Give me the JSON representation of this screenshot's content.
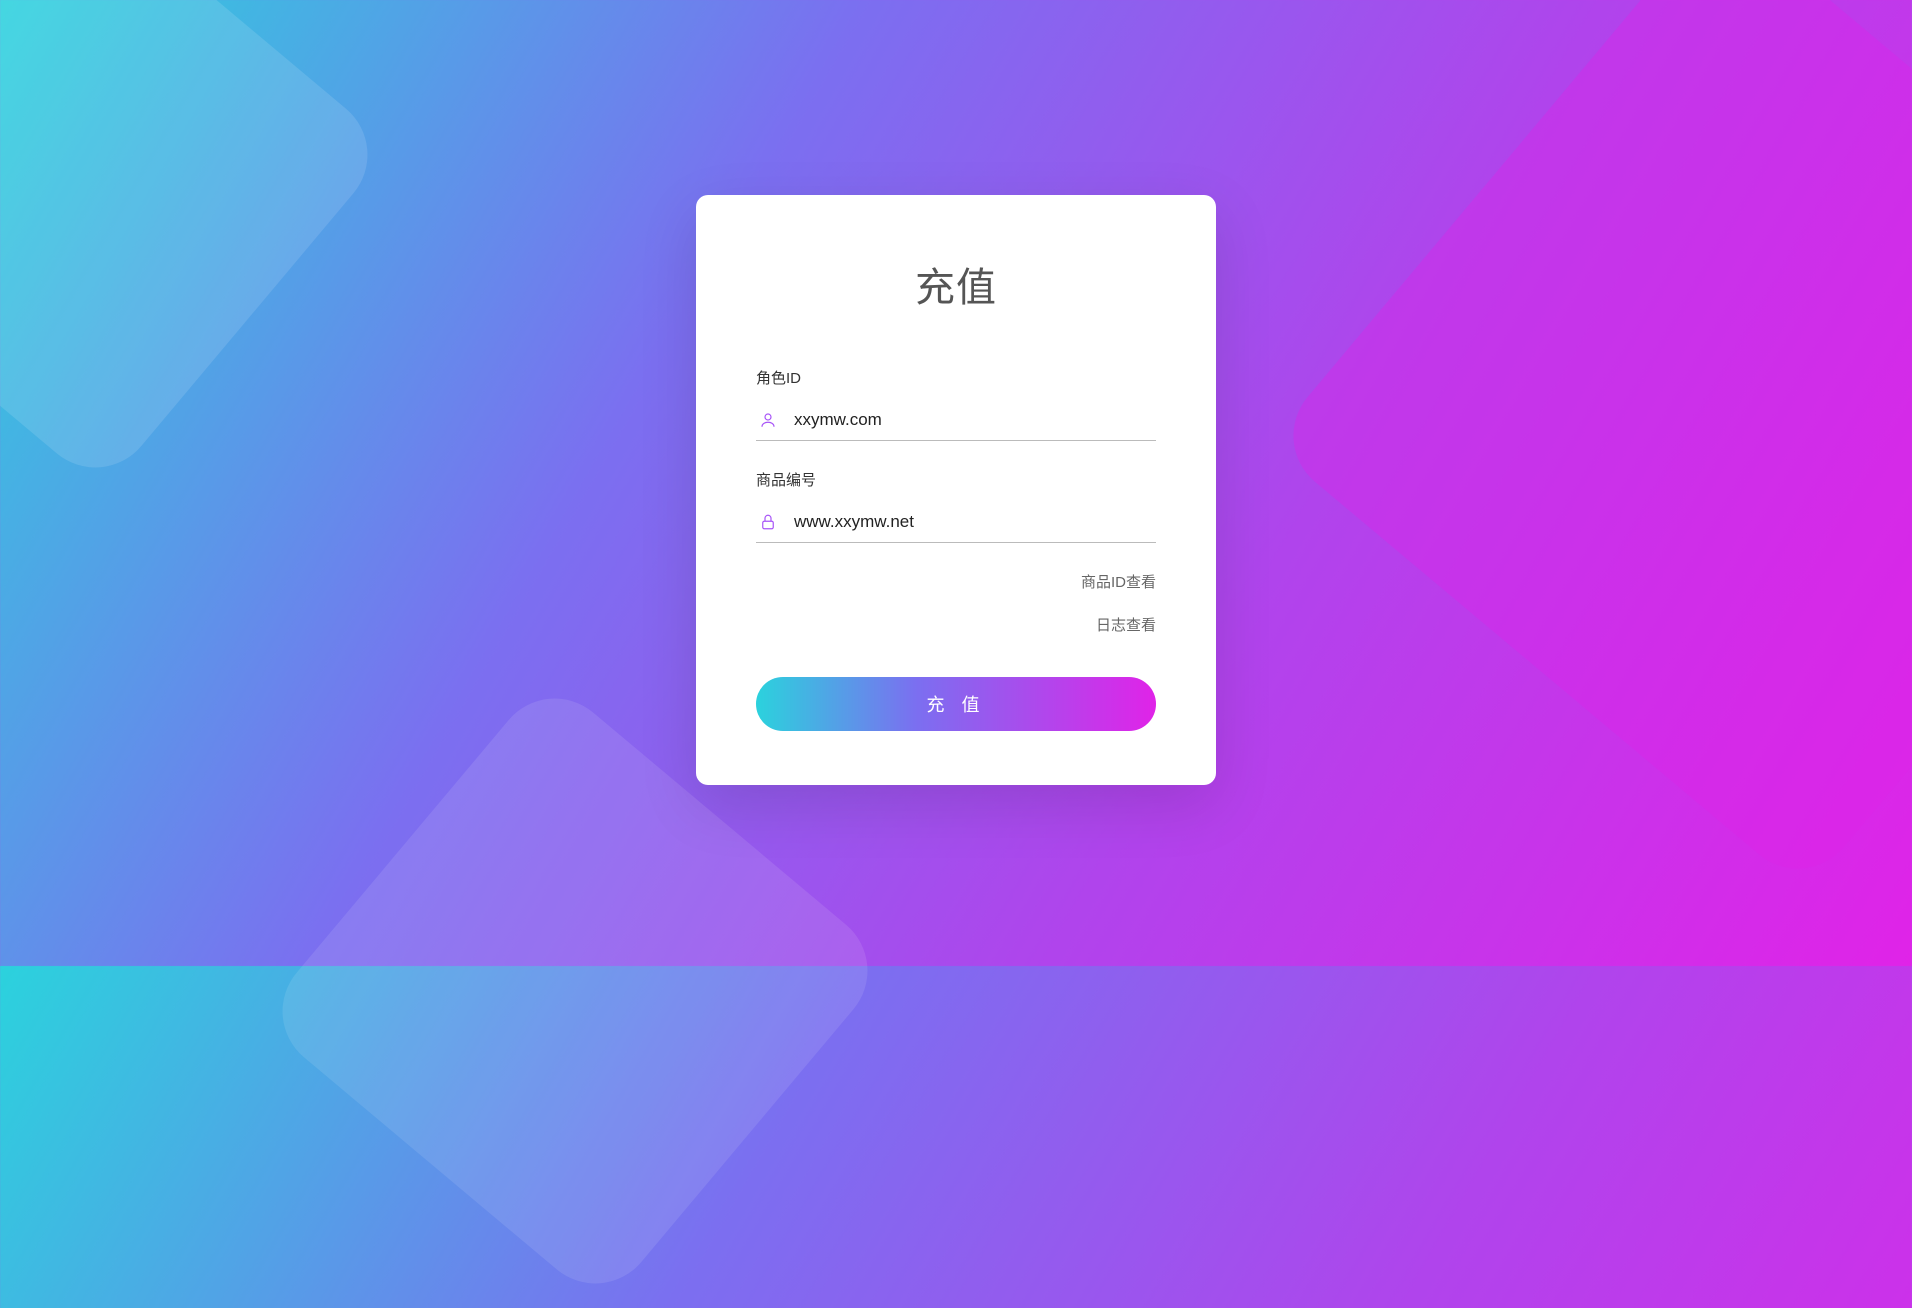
{
  "card": {
    "title": "充值",
    "role_id_label": "角色ID",
    "role_id_value": "xxymw.com",
    "product_id_label": "商品编号",
    "product_id_value": "www.xxymw.net",
    "view_product_link": "商品ID查看",
    "view_log_link": "日志查看",
    "submit_label": "充 值"
  }
}
